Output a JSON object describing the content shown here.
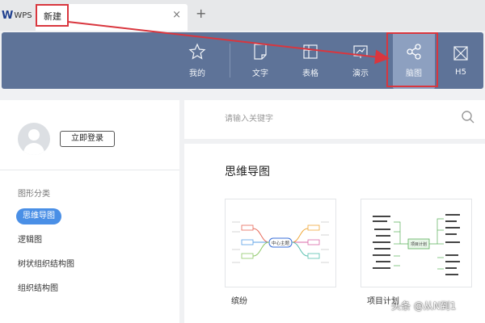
{
  "app": {
    "name": "WPS"
  },
  "tab": {
    "label": "新建",
    "close": "×"
  },
  "toolbar": {
    "items": [
      {
        "label": "我的",
        "icon": "star-icon"
      },
      {
        "label": "文字",
        "icon": "document-icon"
      },
      {
        "label": "表格",
        "icon": "spreadsheet-icon"
      },
      {
        "label": "演示",
        "icon": "presentation-icon"
      },
      {
        "label": "脑图",
        "icon": "mindmap-icon",
        "active": true
      },
      {
        "label": "H5",
        "icon": "h5-icon"
      }
    ]
  },
  "sidebar": {
    "login_label": "立即登录",
    "category_title": "图形分类",
    "items": [
      {
        "label": "思维导图",
        "active": true
      },
      {
        "label": "逻辑图"
      },
      {
        "label": "树状组织结构图"
      },
      {
        "label": "组织结构图"
      }
    ]
  },
  "search": {
    "placeholder": "请输入关键字"
  },
  "main": {
    "section_title": "思维导图",
    "templates": [
      {
        "label": "缤纷",
        "center": "中心主题"
      },
      {
        "label": "项目计划",
        "center": "项目计划"
      }
    ]
  },
  "watermark": "头条 @从N到1",
  "colors": {
    "toolbar": "#5e7398",
    "highlight": "#d9363e",
    "accent": "#4a8fe6"
  }
}
